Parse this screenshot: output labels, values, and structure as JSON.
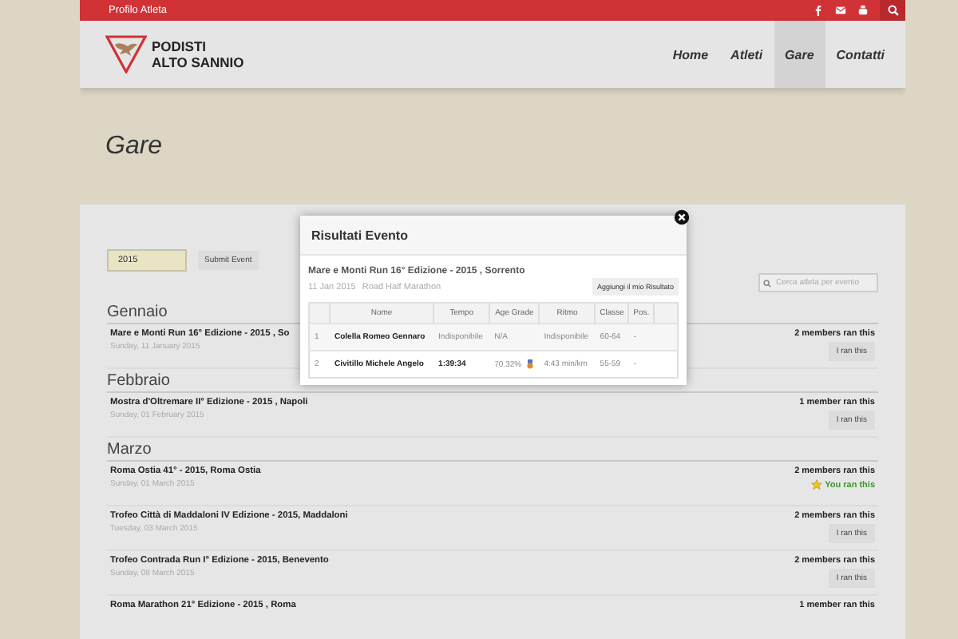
{
  "topbar": {
    "link": "Profilo Atleta"
  },
  "header": {
    "logo_lines": [
      "PODISTI",
      "ALTO SANNIO"
    ],
    "nav": [
      {
        "label": "Home",
        "selected": false
      },
      {
        "label": "Atleti",
        "selected": false
      },
      {
        "label": "Gare",
        "selected": true
      },
      {
        "label": "Contatti",
        "selected": false
      }
    ]
  },
  "page_title": "Gare",
  "filters": {
    "year": "2015",
    "submit": "Submit Event",
    "search_placeholder": "Cerca atleta per evento"
  },
  "months": [
    {
      "name": "Gennaio",
      "events": [
        {
          "title": "Mare e Monti Run 16° Edizione - 2015 , So",
          "date": "Sunday, 11 January 2015",
          "members": "2 members ran this",
          "action": {
            "kind": "button",
            "label": "I ran this"
          }
        }
      ]
    },
    {
      "name": "Febbraio",
      "events": [
        {
          "title": "Mostra d'Oltremare II° Edizione - 2015 , Napoli",
          "date": "Sunday, 01 February 2015",
          "members": "1 member ran this",
          "action": {
            "kind": "button",
            "label": "I ran this"
          }
        }
      ]
    },
    {
      "name": "Marzo",
      "events": [
        {
          "title": "Roma Ostia 41° - 2015, Roma Ostia",
          "date": "Sunday, 01 March 2015",
          "members": "2 members ran this",
          "action": {
            "kind": "done",
            "label": "You ran this"
          }
        },
        {
          "title": "Trofeo Città di Maddaloni IV Edizione - 2015, Maddaloni",
          "date": "Tuesday, 03 March 2015",
          "members": "2 members ran this",
          "action": {
            "kind": "button",
            "label": "I ran this"
          }
        },
        {
          "title": "Trofeo Contrada Run I° Edizione - 2015, Benevento",
          "date": "Sunday, 08 March 2015",
          "members": "2 members ran this",
          "action": {
            "kind": "button",
            "label": "I ran this"
          }
        },
        {
          "title": "Roma Marathon 21° Edizione - 2015 , Roma",
          "members": "1 member ran this"
        }
      ]
    }
  ],
  "modal": {
    "title": "Risultati Evento",
    "event": "Mare e Monti Run 16° Edizione - 2015 , Sorrento",
    "date": "11 Jan 2015",
    "type": "Road Half Marathon",
    "add_button": "Aggiungi il mio Risultato",
    "columns": [
      "Nome",
      "Tempo",
      "Age Grade",
      "Ritmo",
      "Classe",
      "Pos."
    ],
    "rows": [
      {
        "n": "1",
        "name": "Colella Romeo Gennaro",
        "time": "Indisponibile",
        "grade": "N/A",
        "medal": false,
        "pace": "Indisponibile",
        "class": "60-64",
        "pos": "-"
      },
      {
        "n": "2",
        "name": "Civitillo Michele Angelo",
        "time": "1:39:34",
        "grade": "70.32%",
        "medal": true,
        "pace": "4:43 min/km",
        "class": "55-59",
        "pos": "-"
      }
    ]
  }
}
